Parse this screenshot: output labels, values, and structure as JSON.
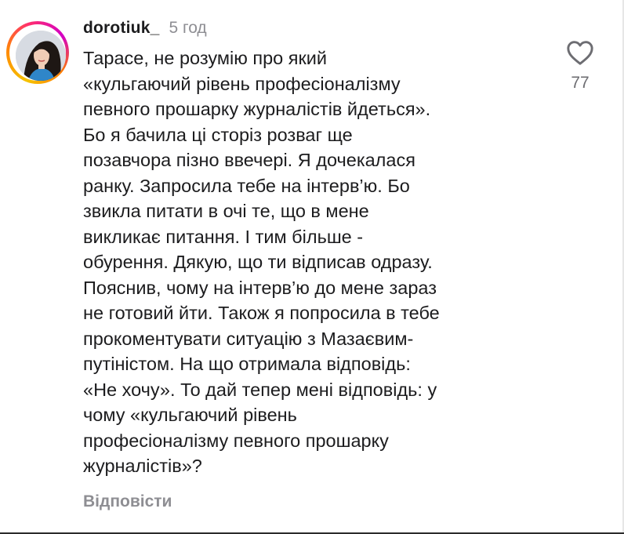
{
  "comment": {
    "username": "dorotiuk_",
    "time": "5 год",
    "text_lines": [
      "Тарасе, не розумію про який",
      "«кульгаючий рівень професіоналізму",
      "певного прошарку журналістів йдеться».",
      "Бо я бачила ці сторіз розваг ще",
      "позавчора пізно ввечері. Я дочекалася",
      "ранку. Запросила тебе на інтерв’ю. Бо",
      "звикла питати в очі те, що в мене",
      "викликає питання. І тим більше -",
      "обурення. Дякую, що ти відписав одразу.",
      "Пояснив, чому на інтерв’ю до мене зараз",
      "не готовий йти. Також я попросила в тебе",
      "прокоментувати ситуацію з Мазаєвим-",
      "путіністом. На що отримала відповідь:",
      "«Не хочу». То дай тепер мені відповідь: у",
      "чому «кульгаючий рівень",
      "професіоналізму певного прошарку",
      "журналістів»?"
    ],
    "reply_label": "Відповісти",
    "like_count": "77",
    "like_icon": "heart-outline-icon",
    "avatar_icon": "profile-avatar"
  },
  "colors": {
    "text": "#1c1c1e",
    "muted": "#8e8e93",
    "ring_start": "#f5c300",
    "ring_mid": "#ff2d6f",
    "ring_end": "#d300c5"
  }
}
